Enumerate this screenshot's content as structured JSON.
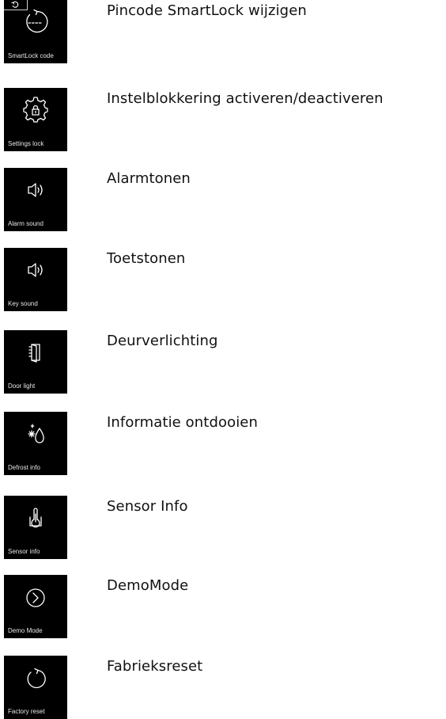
{
  "items": [
    {
      "caption": "SmartLock code",
      "label": "Pincode SmartLock wijzigen",
      "icon": "smartlock-code-icon"
    },
    {
      "caption": "Settings lock",
      "label": "Instelblokkering activeren/deactiveren",
      "icon": "settings-lock-icon"
    },
    {
      "caption": "Alarm sound",
      "label": "Alarmtonen",
      "icon": "speaker-icon"
    },
    {
      "caption": "Key sound",
      "label": "Toetstonen",
      "icon": "speaker-icon"
    },
    {
      "caption": "Door light",
      "label": "Deurverlichting",
      "icon": "door-light-icon"
    },
    {
      "caption": "Defrost info",
      "label": "Informatie ontdooien",
      "icon": "defrost-icon"
    },
    {
      "caption": "Sensor info",
      "label": "Sensor Info",
      "icon": "thermometer-icon"
    },
    {
      "caption": "Demo Mode",
      "label": "DemoMode",
      "icon": "play-circle-icon"
    },
    {
      "caption": "Factory reset",
      "label": "Fabrieksreset",
      "icon": "reset-icon"
    }
  ],
  "colors": {
    "tile": "#000000",
    "icon": "#ffffff",
    "text": "#111111"
  }
}
